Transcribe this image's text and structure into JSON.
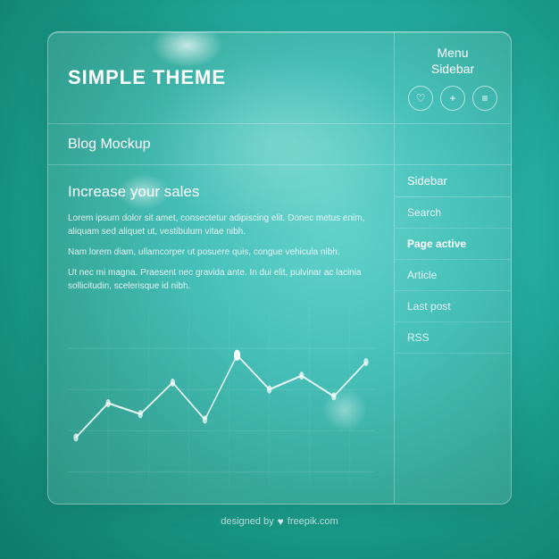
{
  "header": {
    "site_title": "SIMPLE THEME",
    "menu_label": "Menu\nSidebar",
    "icons": [
      {
        "name": "heart-icon",
        "symbol": "♡"
      },
      {
        "name": "plus-icon",
        "symbol": "+"
      },
      {
        "name": "menu-icon",
        "symbol": "≡"
      }
    ]
  },
  "subheader": {
    "blog_label": "Blog Mockup"
  },
  "content": {
    "heading": "Increase your sales",
    "paragraphs": [
      "Lorem ipsum dolor sit amet, consectetur adipiscing elit. Donec metus enim, aliquam sed aliquet ut, vestibulum vitae nibh.",
      "Nam lorem diam, ullamcorper ut posuere quis, congue vehicula nibh.",
      "Ut nec mi magna. Praesent nec gravida ante. In dui elit, pulvinar ac lacinia sollicitudin, scelerisque id nibh."
    ]
  },
  "sidebar": {
    "header": "Sidebar",
    "items": [
      {
        "label": "Search",
        "active": false
      },
      {
        "label": "Page active",
        "active": true
      },
      {
        "label": "Article",
        "active": false
      },
      {
        "label": "Last post",
        "active": false
      },
      {
        "label": "RSS",
        "active": false
      }
    ]
  },
  "chart": {
    "points": [
      [
        10,
        85
      ],
      [
        50,
        65
      ],
      [
        90,
        72
      ],
      [
        130,
        50
      ],
      [
        170,
        78
      ],
      [
        210,
        30
      ],
      [
        250,
        55
      ],
      [
        290,
        45
      ],
      [
        330,
        60
      ],
      [
        370,
        35
      ]
    ]
  },
  "footer": {
    "text": "designed by",
    "brand": "freepik.com"
  }
}
